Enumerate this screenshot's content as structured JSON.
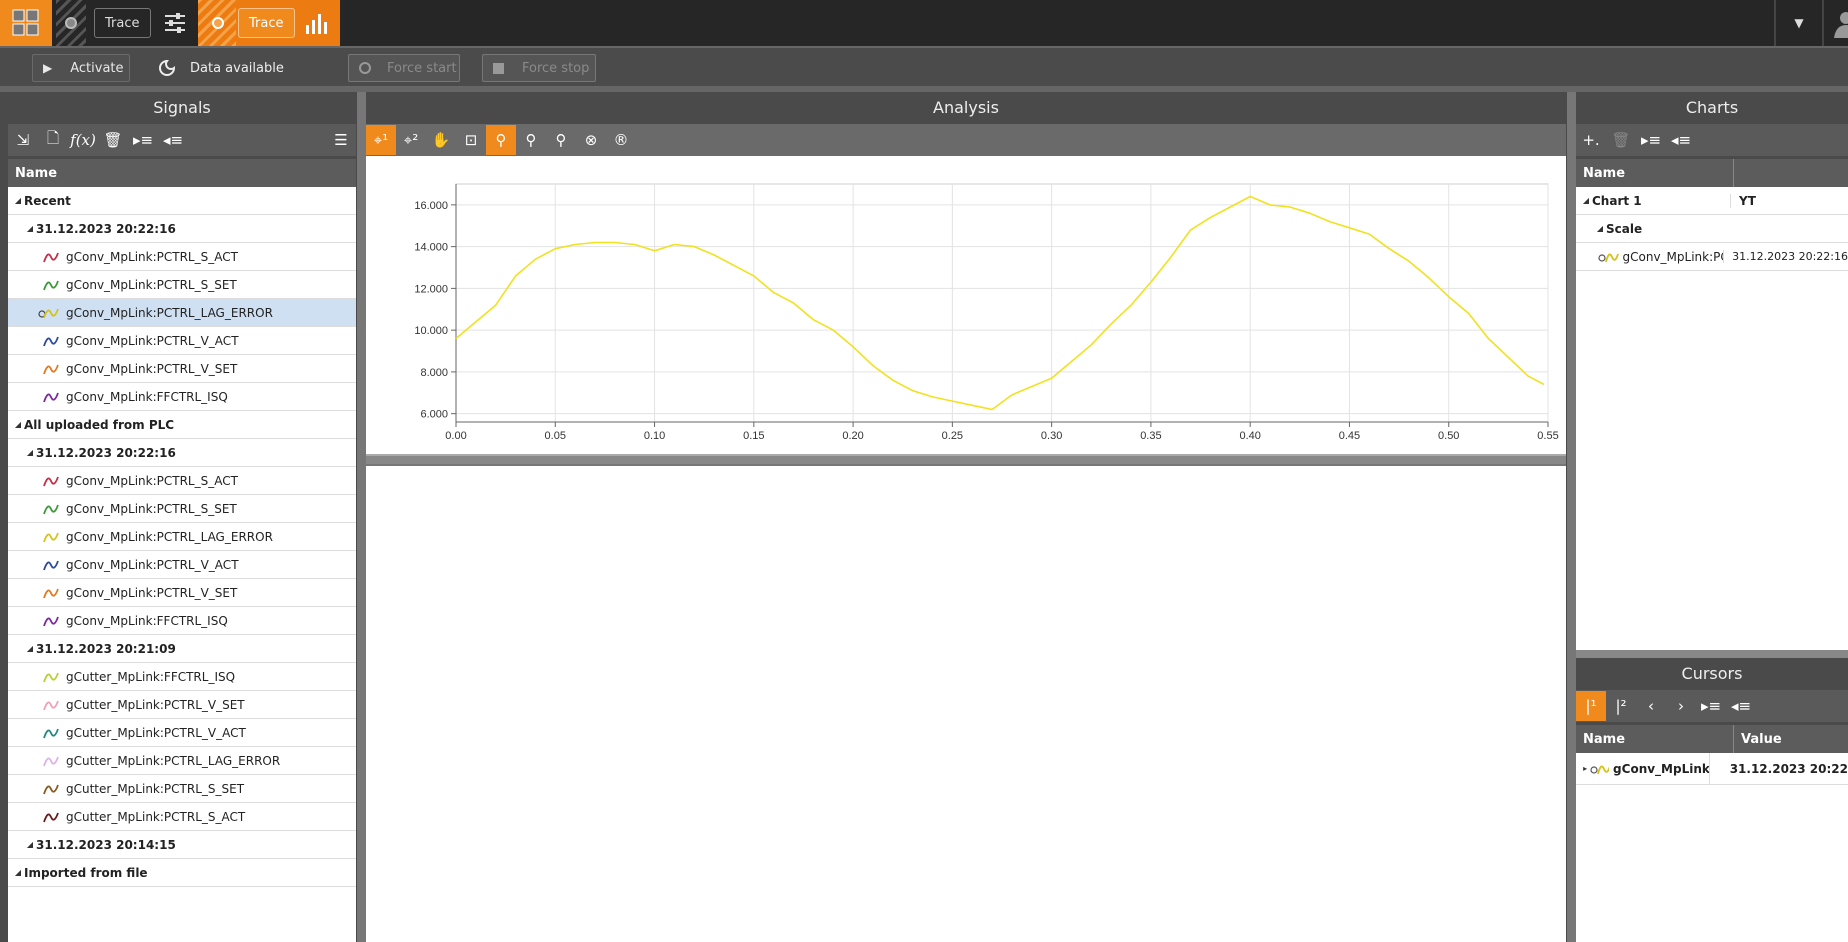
{
  "topbar": {
    "tab1_label": "Trace",
    "tab2_label": "Trace"
  },
  "toolbar": {
    "activate_label": "Activate",
    "data_available_label": "Data available",
    "force_start_label": "Force start",
    "force_stop_label": "Force stop"
  },
  "signals": {
    "title": "Signals",
    "column_name": "Name",
    "rows": [
      {
        "type": "group",
        "level": 0,
        "label": "Recent"
      },
      {
        "type": "group",
        "level": 1,
        "label": "31.12.2023 20:22:16"
      },
      {
        "type": "signal",
        "label": "gConv_MpLink:PCTRL_S_ACT",
        "color": "#c0304a"
      },
      {
        "type": "signal",
        "label": "gConv_MpLink:PCTRL_S_SET",
        "color": "#3a9a3a"
      },
      {
        "type": "signal",
        "label": "gConv_MpLink:PCTRL_LAG_ERROR",
        "color": "#d4c417",
        "selected": true
      },
      {
        "type": "signal",
        "label": "gConv_MpLink:PCTRL_V_ACT",
        "color": "#2c4a9e"
      },
      {
        "type": "signal",
        "label": "gConv_MpLink:PCTRL_V_SET",
        "color": "#e07a20"
      },
      {
        "type": "signal",
        "label": "gConv_MpLink:FFCTRL_ISQ",
        "color": "#7a2a9e"
      },
      {
        "type": "group",
        "level": 0,
        "label": "All uploaded from PLC"
      },
      {
        "type": "group",
        "level": 1,
        "label": "31.12.2023 20:22:16"
      },
      {
        "type": "signal",
        "label": "gConv_MpLink:PCTRL_S_ACT",
        "color": "#c0304a"
      },
      {
        "type": "signal",
        "label": "gConv_MpLink:PCTRL_S_SET",
        "color": "#3a9a3a"
      },
      {
        "type": "signal",
        "label": "gConv_MpLink:PCTRL_LAG_ERROR",
        "color": "#d4c417"
      },
      {
        "type": "signal",
        "label": "gConv_MpLink:PCTRL_V_ACT",
        "color": "#2c4a9e"
      },
      {
        "type": "signal",
        "label": "gConv_MpLink:PCTRL_V_SET",
        "color": "#e07a20"
      },
      {
        "type": "signal",
        "label": "gConv_MpLink:FFCTRL_ISQ",
        "color": "#7a2a9e"
      },
      {
        "type": "group",
        "level": 1,
        "label": "31.12.2023 20:21:09"
      },
      {
        "type": "signal",
        "label": "gCutter_MpLink:FFCTRL_ISQ",
        "color": "#b8d030"
      },
      {
        "type": "signal",
        "label": "gCutter_MpLink:PCTRL_V_SET",
        "color": "#f0a0b8"
      },
      {
        "type": "signal",
        "label": "gCutter_MpLink:PCTRL_V_ACT",
        "color": "#208a80"
      },
      {
        "type": "signal",
        "label": "gCutter_MpLink:PCTRL_LAG_ERROR",
        "color": "#e0b0e8"
      },
      {
        "type": "signal",
        "label": "gCutter_MpLink:PCTRL_S_SET",
        "color": "#8a5a20"
      },
      {
        "type": "signal",
        "label": "gCutter_MpLink:PCTRL_S_ACT",
        "color": "#6a1a1a"
      },
      {
        "type": "group",
        "level": 1,
        "label": "31.12.2023 20:14:15"
      },
      {
        "type": "group",
        "level": 0,
        "label": "Imported from file"
      }
    ]
  },
  "analysis": {
    "title": "Analysis"
  },
  "chart_data": {
    "type": "line",
    "title": "",
    "xlabel": "",
    "ylabel": "",
    "xlim": [
      0.0,
      0.55
    ],
    "ylim": [
      5.6,
      17.0
    ],
    "grid": true,
    "x_ticks": [
      "0.00",
      "0.05",
      "0.10",
      "0.15",
      "0.20",
      "0.25",
      "0.30",
      "0.35",
      "0.40",
      "0.45",
      "0.50",
      "0.55"
    ],
    "y_ticks": [
      "6.000",
      "8.000",
      "10.000",
      "12.000",
      "14.000",
      "16.000"
    ],
    "y_tick_values": [
      6,
      8,
      10,
      12,
      14,
      16
    ],
    "series": [
      {
        "color": "#f2e11e",
        "x": [
          0.0,
          0.01,
          0.02,
          0.03,
          0.04,
          0.05,
          0.06,
          0.07,
          0.08,
          0.09,
          0.1,
          0.11,
          0.12,
          0.13,
          0.14,
          0.15,
          0.16,
          0.17,
          0.18,
          0.19,
          0.2,
          0.21,
          0.22,
          0.23,
          0.24,
          0.25,
          0.26,
          0.27,
          0.28,
          0.29,
          0.3,
          0.31,
          0.32,
          0.33,
          0.34,
          0.35,
          0.36,
          0.37,
          0.38,
          0.39,
          0.4,
          0.41,
          0.42,
          0.43,
          0.44,
          0.45,
          0.46,
          0.47,
          0.48,
          0.49,
          0.5,
          0.51,
          0.52,
          0.53,
          0.54,
          0.548
        ],
        "y": [
          9.6,
          10.4,
          11.2,
          12.6,
          13.4,
          13.9,
          14.1,
          14.2,
          14.2,
          14.1,
          13.8,
          14.1,
          14.0,
          13.6,
          13.1,
          12.6,
          11.8,
          11.3,
          10.5,
          10.0,
          9.2,
          8.3,
          7.6,
          7.1,
          6.8,
          6.6,
          6.4,
          6.2,
          6.9,
          7.3,
          7.7,
          8.5,
          9.3,
          10.3,
          11.2,
          12.3,
          13.5,
          14.8,
          15.4,
          15.9,
          16.4,
          16.0,
          15.9,
          15.6,
          15.2,
          14.9,
          14.6,
          13.9,
          13.3,
          12.5,
          11.6,
          10.8,
          9.6,
          8.7,
          7.8,
          7.4
        ]
      }
    ]
  },
  "charts": {
    "title": "Charts",
    "column_name": "Name",
    "chart1_label": "Chart 1",
    "chart1_type": "YT",
    "scale_label": "Scale",
    "signal_label": "gConv_MpLink:PCTRL",
    "signal_time": "31.12.2023 20:22:16"
  },
  "cursors": {
    "title": "Cursors",
    "column_name": "Name",
    "column_value": "Value",
    "signal_label": "gConv_MpLink:PCTR",
    "signal_value": "31.12.2023 20:22"
  }
}
